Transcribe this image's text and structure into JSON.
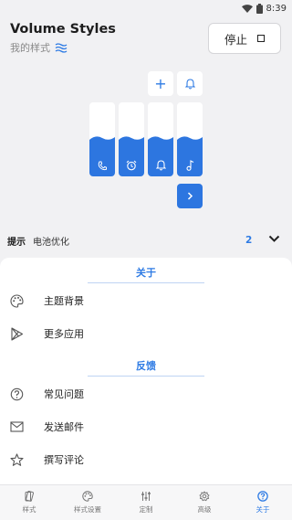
{
  "status_bar": {
    "time": "8:39"
  },
  "header": {
    "title": "Volume Styles",
    "subtitle": "我的样式"
  },
  "stop_button": {
    "label": "停止"
  },
  "controls": {
    "plus_symbol": "+",
    "sliders": [
      {
        "name": "call",
        "level": 0.5
      },
      {
        "name": "alarm",
        "level": 0.5
      },
      {
        "name": "notification",
        "level": 0.5
      },
      {
        "name": "media",
        "level": 0.5
      }
    ]
  },
  "tip": {
    "label": "提示",
    "text": "电池优化",
    "count": "2"
  },
  "about_section": {
    "title": "关于",
    "items": [
      {
        "label": "主题背景",
        "icon": "palette-icon"
      },
      {
        "label": "更多应用",
        "icon": "play-store-icon"
      }
    ]
  },
  "feedback_section": {
    "title": "反馈",
    "items": [
      {
        "label": "常见问题",
        "icon": "help-icon"
      },
      {
        "label": "发送邮件",
        "icon": "mail-icon"
      },
      {
        "label": "撰写评论",
        "icon": "star-icon"
      }
    ]
  },
  "bottom_nav": {
    "items": [
      {
        "label": "样式",
        "icon": "styles-icon"
      },
      {
        "label": "样式设置",
        "icon": "palette-icon"
      },
      {
        "label": "定制",
        "icon": "tune-icon"
      },
      {
        "label": "高级",
        "icon": "gear-icon"
      },
      {
        "label": "关于",
        "icon": "help-icon",
        "active": true
      }
    ]
  },
  "colors": {
    "accent": "#2d76e0",
    "background": "#f1f1f3",
    "sheet": "#ffffff"
  }
}
